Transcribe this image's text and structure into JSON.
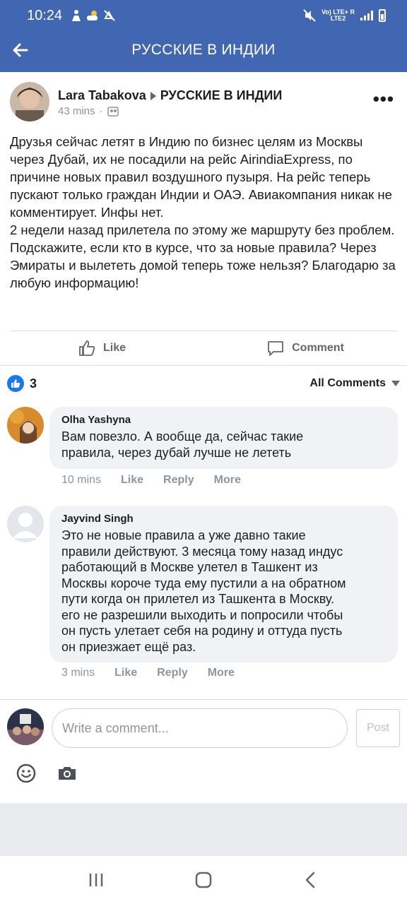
{
  "status_bar": {
    "time": "10:24",
    "network_line1": "Vo) LTE+ R",
    "network_line2": "LTE2"
  },
  "header": {
    "title": "РУССКИЕ В ИНДИИ"
  },
  "post": {
    "author": "Lara Tabakova",
    "group": "РУССКИЕ В ИНДИИ",
    "time": "43 mins",
    "text": "Друзья сейчас летят в Индию по бизнес целям из Москвы через Дубай, их не посадили на рейс AirindiaExpress, по причине новых правил воздушного пузыря. На рейс теперь пускают только граждан Индии и ОАЭ. Авиакомпания никак не комментирует. Инфы нет.\n2 недели назад прилетела по этому же маршруту без проблем.\nПодскажите, если кто в курсе, что за новые правила? Через Эмираты и вылететь домой теперь тоже нельзя? Благодарю за любую информацию!"
  },
  "actions": {
    "like": "Like",
    "comment": "Comment"
  },
  "reactions": {
    "count": "3",
    "filter": "All Comments"
  },
  "comments": [
    {
      "name": "Olha Yashyna",
      "text": "Вам повезло. А вообще да, сейчас такие\nправила, через дубай лучше не лететь",
      "time": "10 mins",
      "like": "Like",
      "reply": "Reply",
      "more": "More"
    },
    {
      "name": "Jayvind Singh",
      "text": "Это не новые правила а уже давно такие\nправили действуют. 3 месяца тому назад индус\nработающий в Москве улетел в Ташкент из\nМосквы короче туда ему пустили а на обратном\nпути когда он прилетел из Ташкента в Москву.\nего не разрешили выходить и попросили чтобы\nон пусть улетает себя на родину и оттуда пусть\nон приезжает ещё раз.",
      "time": "3 mins",
      "like": "Like",
      "reply": "Reply",
      "more": "More"
    }
  ],
  "composer": {
    "placeholder": "Write a comment...",
    "post_label": "Post"
  },
  "colors": {
    "brand": "#4267b2",
    "like_blue": "#1877f2"
  }
}
